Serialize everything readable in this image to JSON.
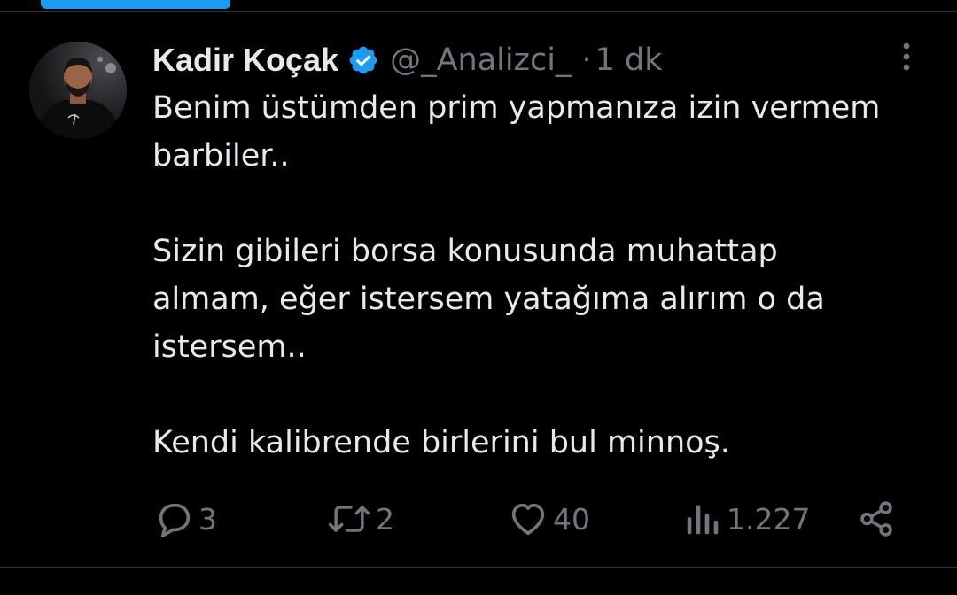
{
  "tweet": {
    "author": {
      "display_name": "Kadir Koçak",
      "handle": "@_Analizci_",
      "verified_icon": "verified-badge-icon",
      "avatar_icon": "avatar"
    },
    "separator": "·",
    "time_ago": "1 dk",
    "paragraphs": [
      "Benim üstümden prim yapmanıza izin vermem\nbarbiler..",
      "Sizin gibileri borsa konusunda muhattap\nalmam, eğer istersem yatağıma alırım o da\nistersem..",
      "Kendi kalibrende birlerini bul minnoş."
    ],
    "actions": {
      "reply": {
        "icon": "reply-icon",
        "count": "3"
      },
      "repost": {
        "icon": "repost-icon",
        "count": "2"
      },
      "like": {
        "icon": "heart-icon",
        "count": "40"
      },
      "views": {
        "icon": "views-icon",
        "count": "1.227"
      },
      "share": {
        "icon": "share-icon"
      }
    }
  },
  "colors": {
    "background": "#000000",
    "text_primary": "#e7e9ea",
    "text_secondary": "#71767b",
    "accent": "#1d9bf0",
    "divider": "#2f3336"
  }
}
